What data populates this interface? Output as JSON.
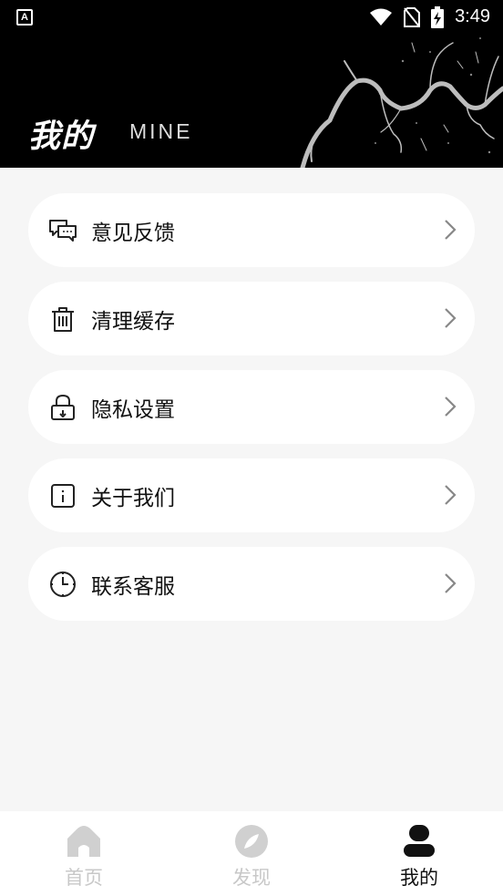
{
  "status_bar": {
    "app_glyph": "A",
    "time": "3:49",
    "icons": [
      "wifi-icon",
      "no-sim-icon",
      "battery-charging-icon"
    ]
  },
  "header": {
    "title": "我的",
    "subtitle": "MINE"
  },
  "menu": {
    "items": [
      {
        "label": "意见反馈",
        "icon": "feedback-chat-icon"
      },
      {
        "label": "清理缓存",
        "icon": "trash-icon"
      },
      {
        "label": "隐私设置",
        "icon": "lock-icon"
      },
      {
        "label": "关于我们",
        "icon": "info-icon"
      },
      {
        "label": "联系客服",
        "icon": "clock-icon"
      }
    ]
  },
  "bottom_nav": {
    "items": [
      {
        "label": "首页",
        "icon": "home-icon",
        "active": false
      },
      {
        "label": "发现",
        "icon": "compass-icon",
        "active": false
      },
      {
        "label": "我的",
        "icon": "profile-icon",
        "active": true
      }
    ]
  },
  "colors": {
    "banner_bg": "#000000",
    "page_bg": "#f6f6f6",
    "card_bg": "#ffffff",
    "nav_inactive": "#c8c8c8",
    "nav_active": "#111111"
  }
}
